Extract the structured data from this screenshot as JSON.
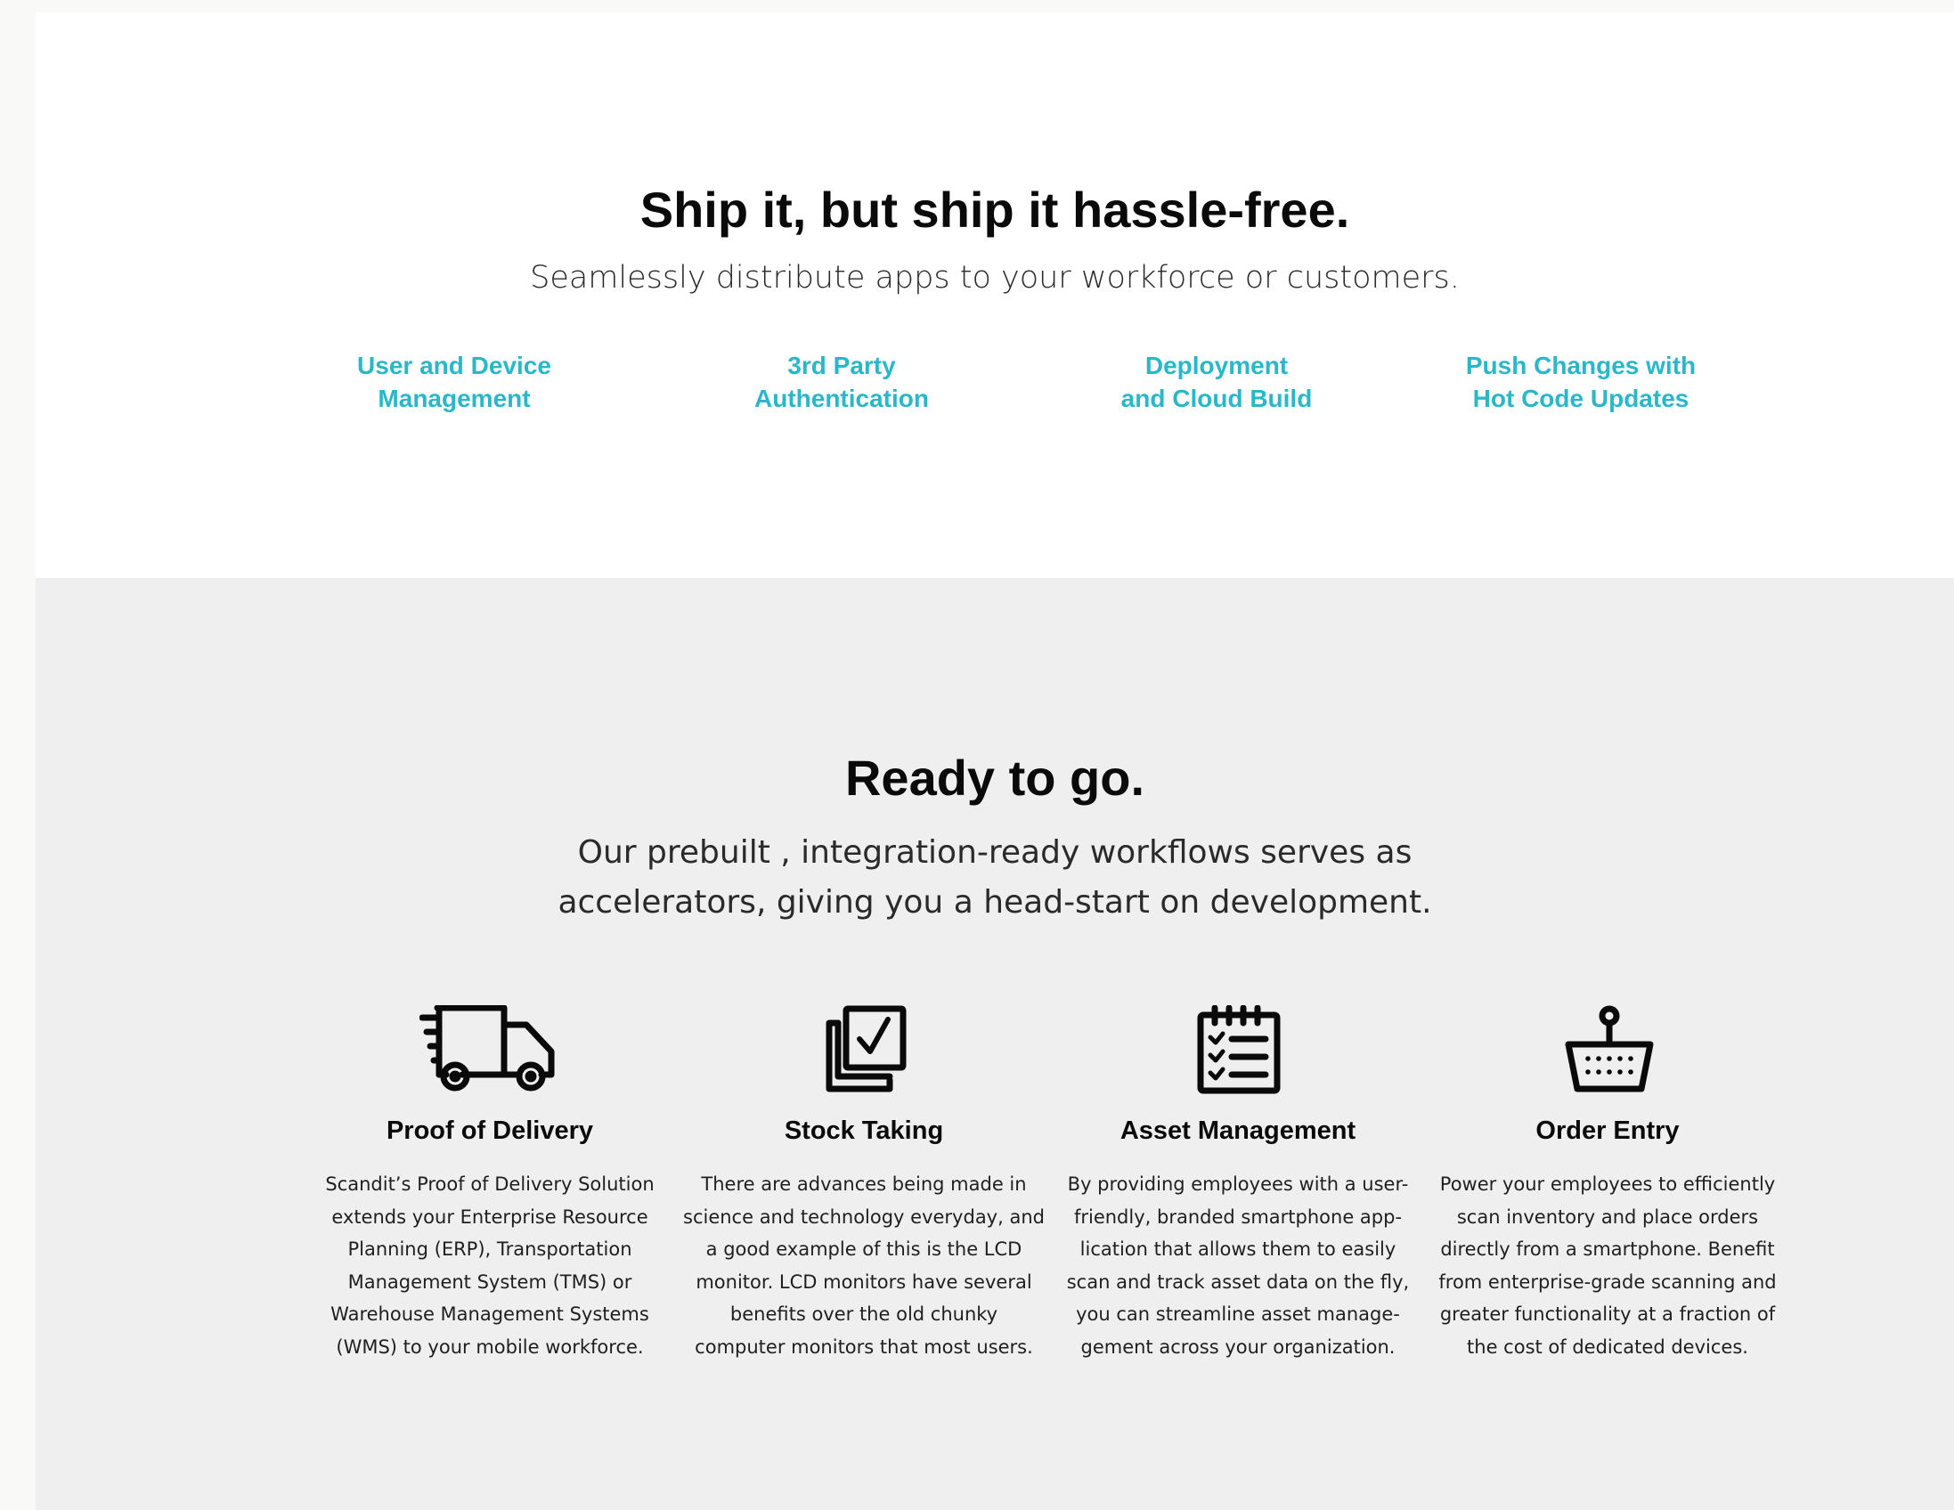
{
  "ship_section": {
    "title": "Ship it, but ship it hassle-free.",
    "subtitle": "Seamlessly distribute apps to your workforce or customers.",
    "links": [
      {
        "label": "User and Device\nManagement"
      },
      {
        "label": "3rd Party\nAuthentication"
      },
      {
        "label": "Deployment\nand Cloud Build"
      },
      {
        "label": "Push Changes with\nHot Code Updates"
      }
    ],
    "link_color": "#2ab7c9"
  },
  "ready_section": {
    "title": "Ready to go.",
    "subtitle_line1": "Our prebuilt , integration-ready workflows serves as",
    "subtitle_line2": "accelerators, giving you a head-start on development.",
    "cards": [
      {
        "icon": "delivery-truck-icon",
        "title": "Proof of Delivery",
        "lines": [
          "Scandit’s Proof of Delivery Solution",
          "extends your Enterprise Resource",
          "Planning (ERP), Transportation",
          "Management System (TMS) or",
          "Warehouse Management Systems",
          "(WMS) to your mobile workforce."
        ]
      },
      {
        "icon": "checkbox-stack-icon",
        "title": "Stock Taking",
        "lines": [
          "There are advances being made in",
          "science and technology everyday, and",
          "a good example of this is the LCD",
          "monitor. LCD monitors have several",
          "benefits over the old chunky",
          "computer monitors that most users."
        ]
      },
      {
        "icon": "checklist-notepad-icon",
        "title": "Asset Management",
        "lines": [
          "By providing employees with a user-",
          "friendly, branded smartphone app-",
          "lication that allows them to easily",
          "scan and track asset data on the fly,",
          "you can streamline asset manage-",
          "gement across your organization."
        ]
      },
      {
        "icon": "shopping-basket-icon",
        "title": "Order Entry",
        "lines": [
          "Power your employees to efficiently",
          "scan inventory and place orders",
          "directly from a smartphone. Benefit",
          "from enterprise-grade scanning and",
          "greater functionality at a fraction of",
          "the cost of dedicated devices."
        ]
      }
    ]
  }
}
